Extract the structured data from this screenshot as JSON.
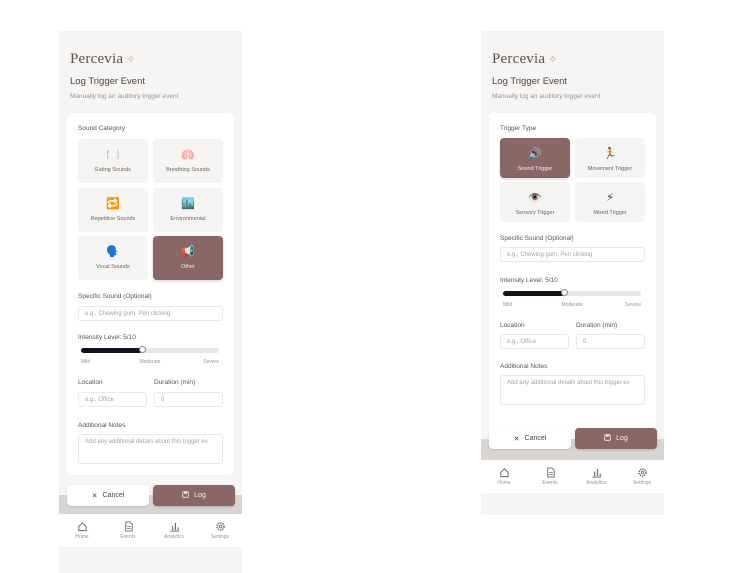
{
  "left": {
    "brand": "Percevia",
    "brand_mark": "✧",
    "title": "Log Trigger Event",
    "subtitle": "Manually log an auditory trigger event",
    "category_label": "Sound Category",
    "categories": [
      {
        "label": "Eating Sounds",
        "icon": "🍽️"
      },
      {
        "label": "Breathing Sounds",
        "icon": "🫁"
      },
      {
        "label": "Repetitive Sounds",
        "icon": "🔁"
      },
      {
        "label": "Environmental",
        "icon": "🏙️"
      },
      {
        "label": "Vocal Sounds",
        "icon": "🗣️"
      },
      {
        "label": "Other",
        "icon": "📢"
      }
    ],
    "selected_category": "Other",
    "specific_label": "Specific Sound (Optional)",
    "specific_placeholder": "e.g., Chewing gum, Pen clicking",
    "intensity_label": "Intensity Level: 5/10",
    "intensity_value": 5,
    "intensity_max": 10,
    "scale": {
      "low": "Mild",
      "mid": "Moderate",
      "high": "Severe"
    },
    "location_label": "Location",
    "location_placeholder": "e.g., Office",
    "duration_label": "Duration (min)",
    "duration_placeholder": "0",
    "notes_label": "Additional Notes",
    "notes_placeholder": "Add any additional details about this trigger ev",
    "cancel_label": "Cancel",
    "log_label": "Log",
    "nav": [
      "Home",
      "Events",
      "Analytics",
      "Settings"
    ]
  },
  "right": {
    "brand": "Percevia",
    "brand_mark": "✧",
    "title": "Log Trigger Event",
    "subtitle": "Manually log an auditory trigger event",
    "type_label": "Trigger Type",
    "types": [
      {
        "label": "Sound Trigger",
        "icon": "🔊"
      },
      {
        "label": "Movement Trigger",
        "icon": "🏃"
      },
      {
        "label": "Sensory Trigger",
        "icon": "👁️"
      },
      {
        "label": "Mixed Trigger",
        "icon": "⚡"
      }
    ],
    "selected_type": "Sound Trigger",
    "specific_label": "Specific Sound (Optional)",
    "specific_placeholder": "e.g., Chewing gum, Pen clicking",
    "intensity_label": "Intensity Level: 5/10",
    "intensity_value": 5,
    "intensity_max": 10,
    "scale": {
      "low": "Mild",
      "mid": "Moderate",
      "high": "Severe"
    },
    "location_label": "Location",
    "location_placeholder": "e.g., Office",
    "duration_label": "Duration (min)",
    "duration_placeholder": "0",
    "notes_label": "Additional Notes",
    "notes_placeholder": "Add any additional details about this trigger ev",
    "cancel_label": "Cancel",
    "log_label": "Log",
    "nav": [
      "Home",
      "Events",
      "Analytics",
      "Settings"
    ]
  },
  "colors": {
    "accent": "#8a6767",
    "slider_fill": "#141020",
    "background": "#f7f5f3"
  }
}
